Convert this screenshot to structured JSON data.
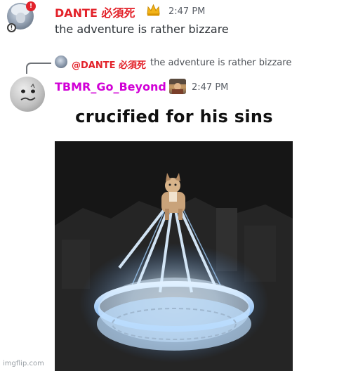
{
  "message1": {
    "username": "DANTE 必須死",
    "timestamp": "2:47 PM",
    "text": "the adventure is rather bizzare",
    "name_color": "#e3222a",
    "badge_icon": "crown-icon"
  },
  "reply": {
    "mention": "@DANTE 必須死",
    "text": "the adventure is rather bizzare"
  },
  "message2": {
    "username": "TBMR_Go_Beyond",
    "timestamp": "2:47 PM",
    "name_color": "#d100d6",
    "badge_icon": "emoji-icon",
    "caption": "crucified for his sins"
  },
  "watermark": "imgflip.com"
}
